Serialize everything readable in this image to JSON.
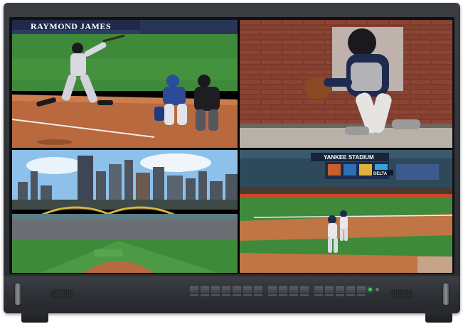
{
  "monitor": {
    "type": "quad-split broadcast monitor"
  },
  "views": [
    {
      "name": "batter-swing",
      "banner_text": "RAYMOND JAMES"
    },
    {
      "name": "catcher-closeup"
    },
    {
      "name": "city-ballpark-aerial"
    },
    {
      "name": "stadium-infield",
      "stadium_text": "YANKEE STADIUM",
      "board_text": "DELTA"
    }
  ],
  "colors": {
    "bezel": "#2c2e33",
    "grass": "#3f8a3a",
    "dirt": "#b8693e",
    "sky": "#8ec1ea",
    "led_active": "#35d05a"
  },
  "controls": {
    "button_count": 16,
    "led_states": [
      "on",
      "off"
    ]
  },
  "icons": [
    "speaker-grille-icon",
    "handle-icon",
    "power-led-icon"
  ]
}
